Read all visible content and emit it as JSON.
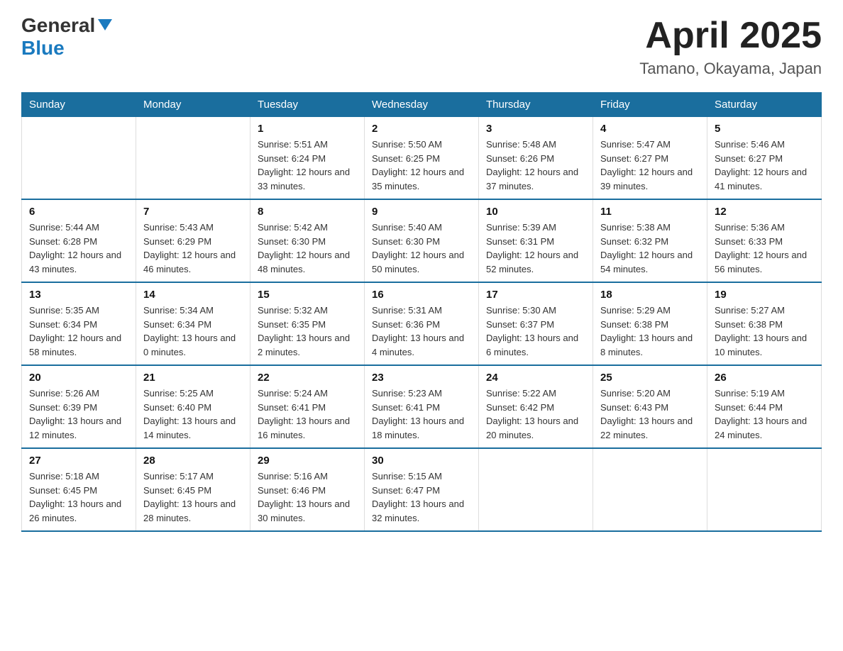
{
  "header": {
    "logo_general": "General",
    "logo_blue": "Blue",
    "title": "April 2025",
    "subtitle": "Tamano, Okayama, Japan"
  },
  "weekdays": [
    "Sunday",
    "Monday",
    "Tuesday",
    "Wednesday",
    "Thursday",
    "Friday",
    "Saturday"
  ],
  "weeks": [
    [
      {
        "day": "",
        "sunrise": "",
        "sunset": "",
        "daylight": ""
      },
      {
        "day": "",
        "sunrise": "",
        "sunset": "",
        "daylight": ""
      },
      {
        "day": "1",
        "sunrise": "Sunrise: 5:51 AM",
        "sunset": "Sunset: 6:24 PM",
        "daylight": "Daylight: 12 hours and 33 minutes."
      },
      {
        "day": "2",
        "sunrise": "Sunrise: 5:50 AM",
        "sunset": "Sunset: 6:25 PM",
        "daylight": "Daylight: 12 hours and 35 minutes."
      },
      {
        "day": "3",
        "sunrise": "Sunrise: 5:48 AM",
        "sunset": "Sunset: 6:26 PM",
        "daylight": "Daylight: 12 hours and 37 minutes."
      },
      {
        "day": "4",
        "sunrise": "Sunrise: 5:47 AM",
        "sunset": "Sunset: 6:27 PM",
        "daylight": "Daylight: 12 hours and 39 minutes."
      },
      {
        "day": "5",
        "sunrise": "Sunrise: 5:46 AM",
        "sunset": "Sunset: 6:27 PM",
        "daylight": "Daylight: 12 hours and 41 minutes."
      }
    ],
    [
      {
        "day": "6",
        "sunrise": "Sunrise: 5:44 AM",
        "sunset": "Sunset: 6:28 PM",
        "daylight": "Daylight: 12 hours and 43 minutes."
      },
      {
        "day": "7",
        "sunrise": "Sunrise: 5:43 AM",
        "sunset": "Sunset: 6:29 PM",
        "daylight": "Daylight: 12 hours and 46 minutes."
      },
      {
        "day": "8",
        "sunrise": "Sunrise: 5:42 AM",
        "sunset": "Sunset: 6:30 PM",
        "daylight": "Daylight: 12 hours and 48 minutes."
      },
      {
        "day": "9",
        "sunrise": "Sunrise: 5:40 AM",
        "sunset": "Sunset: 6:30 PM",
        "daylight": "Daylight: 12 hours and 50 minutes."
      },
      {
        "day": "10",
        "sunrise": "Sunrise: 5:39 AM",
        "sunset": "Sunset: 6:31 PM",
        "daylight": "Daylight: 12 hours and 52 minutes."
      },
      {
        "day": "11",
        "sunrise": "Sunrise: 5:38 AM",
        "sunset": "Sunset: 6:32 PM",
        "daylight": "Daylight: 12 hours and 54 minutes."
      },
      {
        "day": "12",
        "sunrise": "Sunrise: 5:36 AM",
        "sunset": "Sunset: 6:33 PM",
        "daylight": "Daylight: 12 hours and 56 minutes."
      }
    ],
    [
      {
        "day": "13",
        "sunrise": "Sunrise: 5:35 AM",
        "sunset": "Sunset: 6:34 PM",
        "daylight": "Daylight: 12 hours and 58 minutes."
      },
      {
        "day": "14",
        "sunrise": "Sunrise: 5:34 AM",
        "sunset": "Sunset: 6:34 PM",
        "daylight": "Daylight: 13 hours and 0 minutes."
      },
      {
        "day": "15",
        "sunrise": "Sunrise: 5:32 AM",
        "sunset": "Sunset: 6:35 PM",
        "daylight": "Daylight: 13 hours and 2 minutes."
      },
      {
        "day": "16",
        "sunrise": "Sunrise: 5:31 AM",
        "sunset": "Sunset: 6:36 PM",
        "daylight": "Daylight: 13 hours and 4 minutes."
      },
      {
        "day": "17",
        "sunrise": "Sunrise: 5:30 AM",
        "sunset": "Sunset: 6:37 PM",
        "daylight": "Daylight: 13 hours and 6 minutes."
      },
      {
        "day": "18",
        "sunrise": "Sunrise: 5:29 AM",
        "sunset": "Sunset: 6:38 PM",
        "daylight": "Daylight: 13 hours and 8 minutes."
      },
      {
        "day": "19",
        "sunrise": "Sunrise: 5:27 AM",
        "sunset": "Sunset: 6:38 PM",
        "daylight": "Daylight: 13 hours and 10 minutes."
      }
    ],
    [
      {
        "day": "20",
        "sunrise": "Sunrise: 5:26 AM",
        "sunset": "Sunset: 6:39 PM",
        "daylight": "Daylight: 13 hours and 12 minutes."
      },
      {
        "day": "21",
        "sunrise": "Sunrise: 5:25 AM",
        "sunset": "Sunset: 6:40 PM",
        "daylight": "Daylight: 13 hours and 14 minutes."
      },
      {
        "day": "22",
        "sunrise": "Sunrise: 5:24 AM",
        "sunset": "Sunset: 6:41 PM",
        "daylight": "Daylight: 13 hours and 16 minutes."
      },
      {
        "day": "23",
        "sunrise": "Sunrise: 5:23 AM",
        "sunset": "Sunset: 6:41 PM",
        "daylight": "Daylight: 13 hours and 18 minutes."
      },
      {
        "day": "24",
        "sunrise": "Sunrise: 5:22 AM",
        "sunset": "Sunset: 6:42 PM",
        "daylight": "Daylight: 13 hours and 20 minutes."
      },
      {
        "day": "25",
        "sunrise": "Sunrise: 5:20 AM",
        "sunset": "Sunset: 6:43 PM",
        "daylight": "Daylight: 13 hours and 22 minutes."
      },
      {
        "day": "26",
        "sunrise": "Sunrise: 5:19 AM",
        "sunset": "Sunset: 6:44 PM",
        "daylight": "Daylight: 13 hours and 24 minutes."
      }
    ],
    [
      {
        "day": "27",
        "sunrise": "Sunrise: 5:18 AM",
        "sunset": "Sunset: 6:45 PM",
        "daylight": "Daylight: 13 hours and 26 minutes."
      },
      {
        "day": "28",
        "sunrise": "Sunrise: 5:17 AM",
        "sunset": "Sunset: 6:45 PM",
        "daylight": "Daylight: 13 hours and 28 minutes."
      },
      {
        "day": "29",
        "sunrise": "Sunrise: 5:16 AM",
        "sunset": "Sunset: 6:46 PM",
        "daylight": "Daylight: 13 hours and 30 minutes."
      },
      {
        "day": "30",
        "sunrise": "Sunrise: 5:15 AM",
        "sunset": "Sunset: 6:47 PM",
        "daylight": "Daylight: 13 hours and 32 minutes."
      },
      {
        "day": "",
        "sunrise": "",
        "sunset": "",
        "daylight": ""
      },
      {
        "day": "",
        "sunrise": "",
        "sunset": "",
        "daylight": ""
      },
      {
        "day": "",
        "sunrise": "",
        "sunset": "",
        "daylight": ""
      }
    ]
  ]
}
